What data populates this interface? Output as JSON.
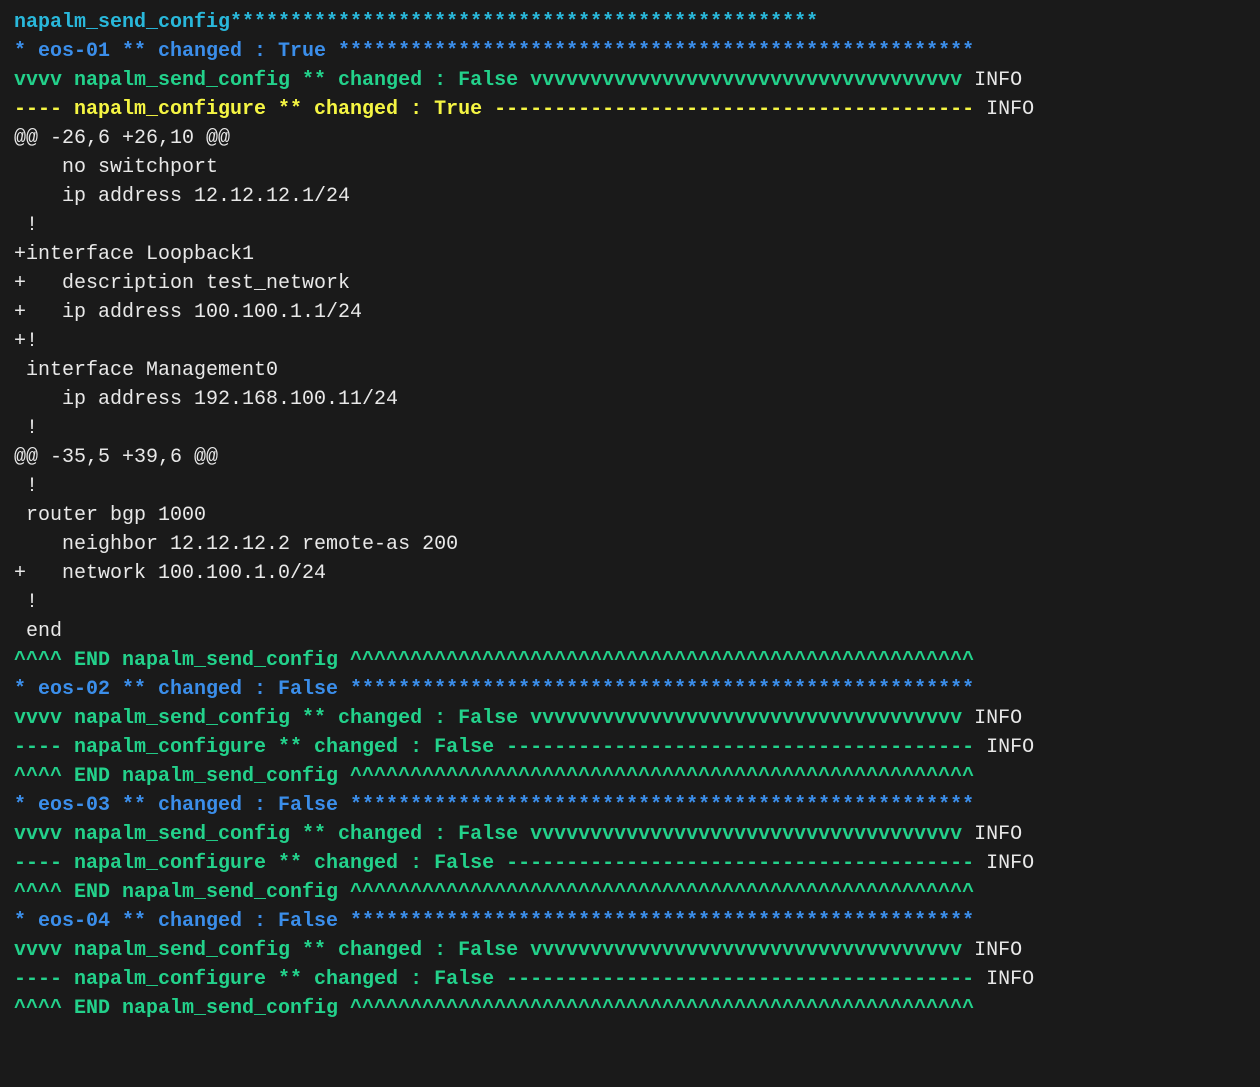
{
  "lines": [
    {
      "cls": "cyan",
      "text": "napalm_send_config*************************************************"
    },
    {
      "cls": "blue",
      "text": "* eos-01 ** changed : True *****************************************************"
    },
    {
      "spans": [
        {
          "cls": "green",
          "text": "vvvv napalm_send_config ** changed : False vvvvvvvvvvvvvvvvvvvvvvvvvvvvvvvvvvvv "
        },
        {
          "cls": "plain",
          "text": "INFO"
        }
      ]
    },
    {
      "spans": [
        {
          "cls": "yellow",
          "text": "---- napalm_configure ** changed : True ---------------------------------------- "
        },
        {
          "cls": "plain",
          "text": "INFO"
        }
      ]
    },
    {
      "cls": "plain",
      "text": "@@ -26,6 +26,10 @@"
    },
    {
      "cls": "plain",
      "text": "    no switchport"
    },
    {
      "cls": "plain",
      "text": "    ip address 12.12.12.1/24"
    },
    {
      "cls": "plain",
      "text": " !"
    },
    {
      "cls": "plain",
      "text": "+interface Loopback1"
    },
    {
      "cls": "plain",
      "text": "+   description test_network"
    },
    {
      "cls": "plain",
      "text": "+   ip address 100.100.1.1/24"
    },
    {
      "cls": "plain",
      "text": "+!"
    },
    {
      "cls": "plain",
      "text": " interface Management0"
    },
    {
      "cls": "plain",
      "text": "    ip address 192.168.100.11/24"
    },
    {
      "cls": "plain",
      "text": " !"
    },
    {
      "cls": "plain",
      "text": "@@ -35,5 +39,6 @@"
    },
    {
      "cls": "plain",
      "text": " !"
    },
    {
      "cls": "plain",
      "text": " router bgp 1000"
    },
    {
      "cls": "plain",
      "text": "    neighbor 12.12.12.2 remote-as 200"
    },
    {
      "cls": "plain",
      "text": "+   network 100.100.1.0/24"
    },
    {
      "cls": "plain",
      "text": " !"
    },
    {
      "cls": "plain",
      "text": " end"
    },
    {
      "cls": "green",
      "text": "^^^^ END napalm_send_config ^^^^^^^^^^^^^^^^^^^^^^^^^^^^^^^^^^^^^^^^^^^^^^^^^^^^"
    },
    {
      "cls": "blue",
      "text": "* eos-02 ** changed : False ****************************************************"
    },
    {
      "spans": [
        {
          "cls": "green",
          "text": "vvvv napalm_send_config ** changed : False vvvvvvvvvvvvvvvvvvvvvvvvvvvvvvvvvvvv "
        },
        {
          "cls": "plain",
          "text": "INFO"
        }
      ]
    },
    {
      "spans": [
        {
          "cls": "green",
          "text": "---- napalm_configure ** changed : False --------------------------------------- "
        },
        {
          "cls": "plain",
          "text": "INFO"
        }
      ]
    },
    {
      "cls": "green",
      "text": "^^^^ END napalm_send_config ^^^^^^^^^^^^^^^^^^^^^^^^^^^^^^^^^^^^^^^^^^^^^^^^^^^^"
    },
    {
      "cls": "blue",
      "text": "* eos-03 ** changed : False ****************************************************"
    },
    {
      "spans": [
        {
          "cls": "green",
          "text": "vvvv napalm_send_config ** changed : False vvvvvvvvvvvvvvvvvvvvvvvvvvvvvvvvvvvv "
        },
        {
          "cls": "plain",
          "text": "INFO"
        }
      ]
    },
    {
      "spans": [
        {
          "cls": "green",
          "text": "---- napalm_configure ** changed : False --------------------------------------- "
        },
        {
          "cls": "plain",
          "text": "INFO"
        }
      ]
    },
    {
      "cls": "green",
      "text": "^^^^ END napalm_send_config ^^^^^^^^^^^^^^^^^^^^^^^^^^^^^^^^^^^^^^^^^^^^^^^^^^^^"
    },
    {
      "cls": "blue",
      "text": "* eos-04 ** changed : False ****************************************************"
    },
    {
      "spans": [
        {
          "cls": "green",
          "text": "vvvv napalm_send_config ** changed : False vvvvvvvvvvvvvvvvvvvvvvvvvvvvvvvvvvvv "
        },
        {
          "cls": "plain",
          "text": "INFO"
        }
      ]
    },
    {
      "spans": [
        {
          "cls": "green",
          "text": "---- napalm_configure ** changed : False --------------------------------------- "
        },
        {
          "cls": "plain",
          "text": "INFO"
        }
      ]
    },
    {
      "cls": "green",
      "text": "^^^^ END napalm_send_config ^^^^^^^^^^^^^^^^^^^^^^^^^^^^^^^^^^^^^^^^^^^^^^^^^^^^"
    }
  ]
}
